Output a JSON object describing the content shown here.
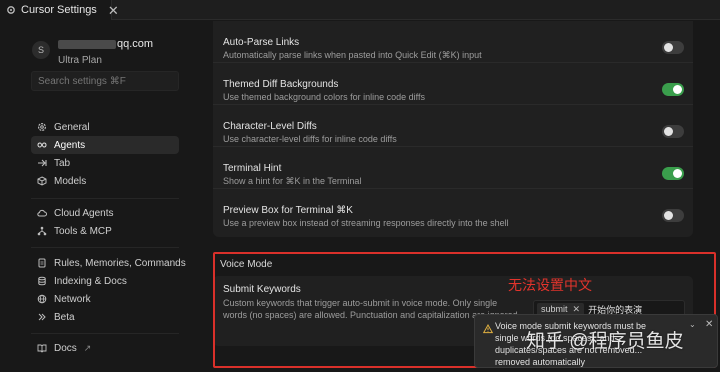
{
  "tab": {
    "title": "Cursor Settings",
    "close": "✕"
  },
  "user": {
    "avatar": "S",
    "email_suffix": "qq.com",
    "plan": "Ultra Plan"
  },
  "search": {
    "placeholder": "Search settings ⌘F"
  },
  "nav": {
    "group1": [
      {
        "label": "General",
        "icon": "gear-icon"
      },
      {
        "label": "Agents",
        "icon": "infinity-icon",
        "active": true
      },
      {
        "label": "Tab",
        "icon": "tab-arrow-icon"
      },
      {
        "label": "Models",
        "icon": "cube-icon"
      }
    ],
    "group2": [
      {
        "label": "Cloud Agents",
        "icon": "cloud-icon"
      },
      {
        "label": "Tools & MCP",
        "icon": "tools-icon"
      }
    ],
    "group3": [
      {
        "label": "Rules, Memories, Commands",
        "icon": "document-icon"
      },
      {
        "label": "Indexing & Docs",
        "icon": "database-icon"
      },
      {
        "label": "Network",
        "icon": "globe-icon"
      },
      {
        "label": "Beta",
        "icon": "beta-icon"
      }
    ],
    "docs": {
      "label": "Docs",
      "icon": "book-icon",
      "external": "↗"
    }
  },
  "settings": [
    {
      "title": "Auto-Parse Links",
      "desc": "Automatically parse links when pasted into Quick Edit (⌘K) input",
      "on": false
    },
    {
      "title": "Themed Diff Backgrounds",
      "desc": "Use themed background colors for inline code diffs",
      "on": true
    },
    {
      "title": "Character-Level Diffs",
      "desc": "Use character-level diffs for inline code diffs",
      "on": false
    },
    {
      "title": "Terminal Hint",
      "desc": "Show a hint for ⌘K in the Terminal",
      "on": true
    },
    {
      "title": "Preview Box for Terminal ⌘K",
      "desc": "Use a preview box instead of streaming responses directly into the shell",
      "on": false
    }
  ],
  "voice": {
    "section_title": "Voice Mode",
    "title": "Submit Keywords",
    "desc": "Custom keywords that trigger auto-submit in voice mode. Only single words (no spaces) are allowed. Punctuation and capitalization are ignored.",
    "chip": "submit",
    "chip_close": "✕",
    "input_value": "开始你的表演"
  },
  "annotation": {
    "label": "无法设置中文",
    "color": "#d9302a"
  },
  "toast": {
    "text": "Voice mode submit keywords must be single words (no spaces), and duplicates/spaces are not removed... removed automatically",
    "chevron": "⌄",
    "close": "✕"
  },
  "watermark": "知乎 @程序员鱼皮",
  "colors": {
    "toggle_on": "#3a9e4c",
    "toggle_off": "#3d3d3d",
    "background": "#181818",
    "panel": "#202020"
  }
}
